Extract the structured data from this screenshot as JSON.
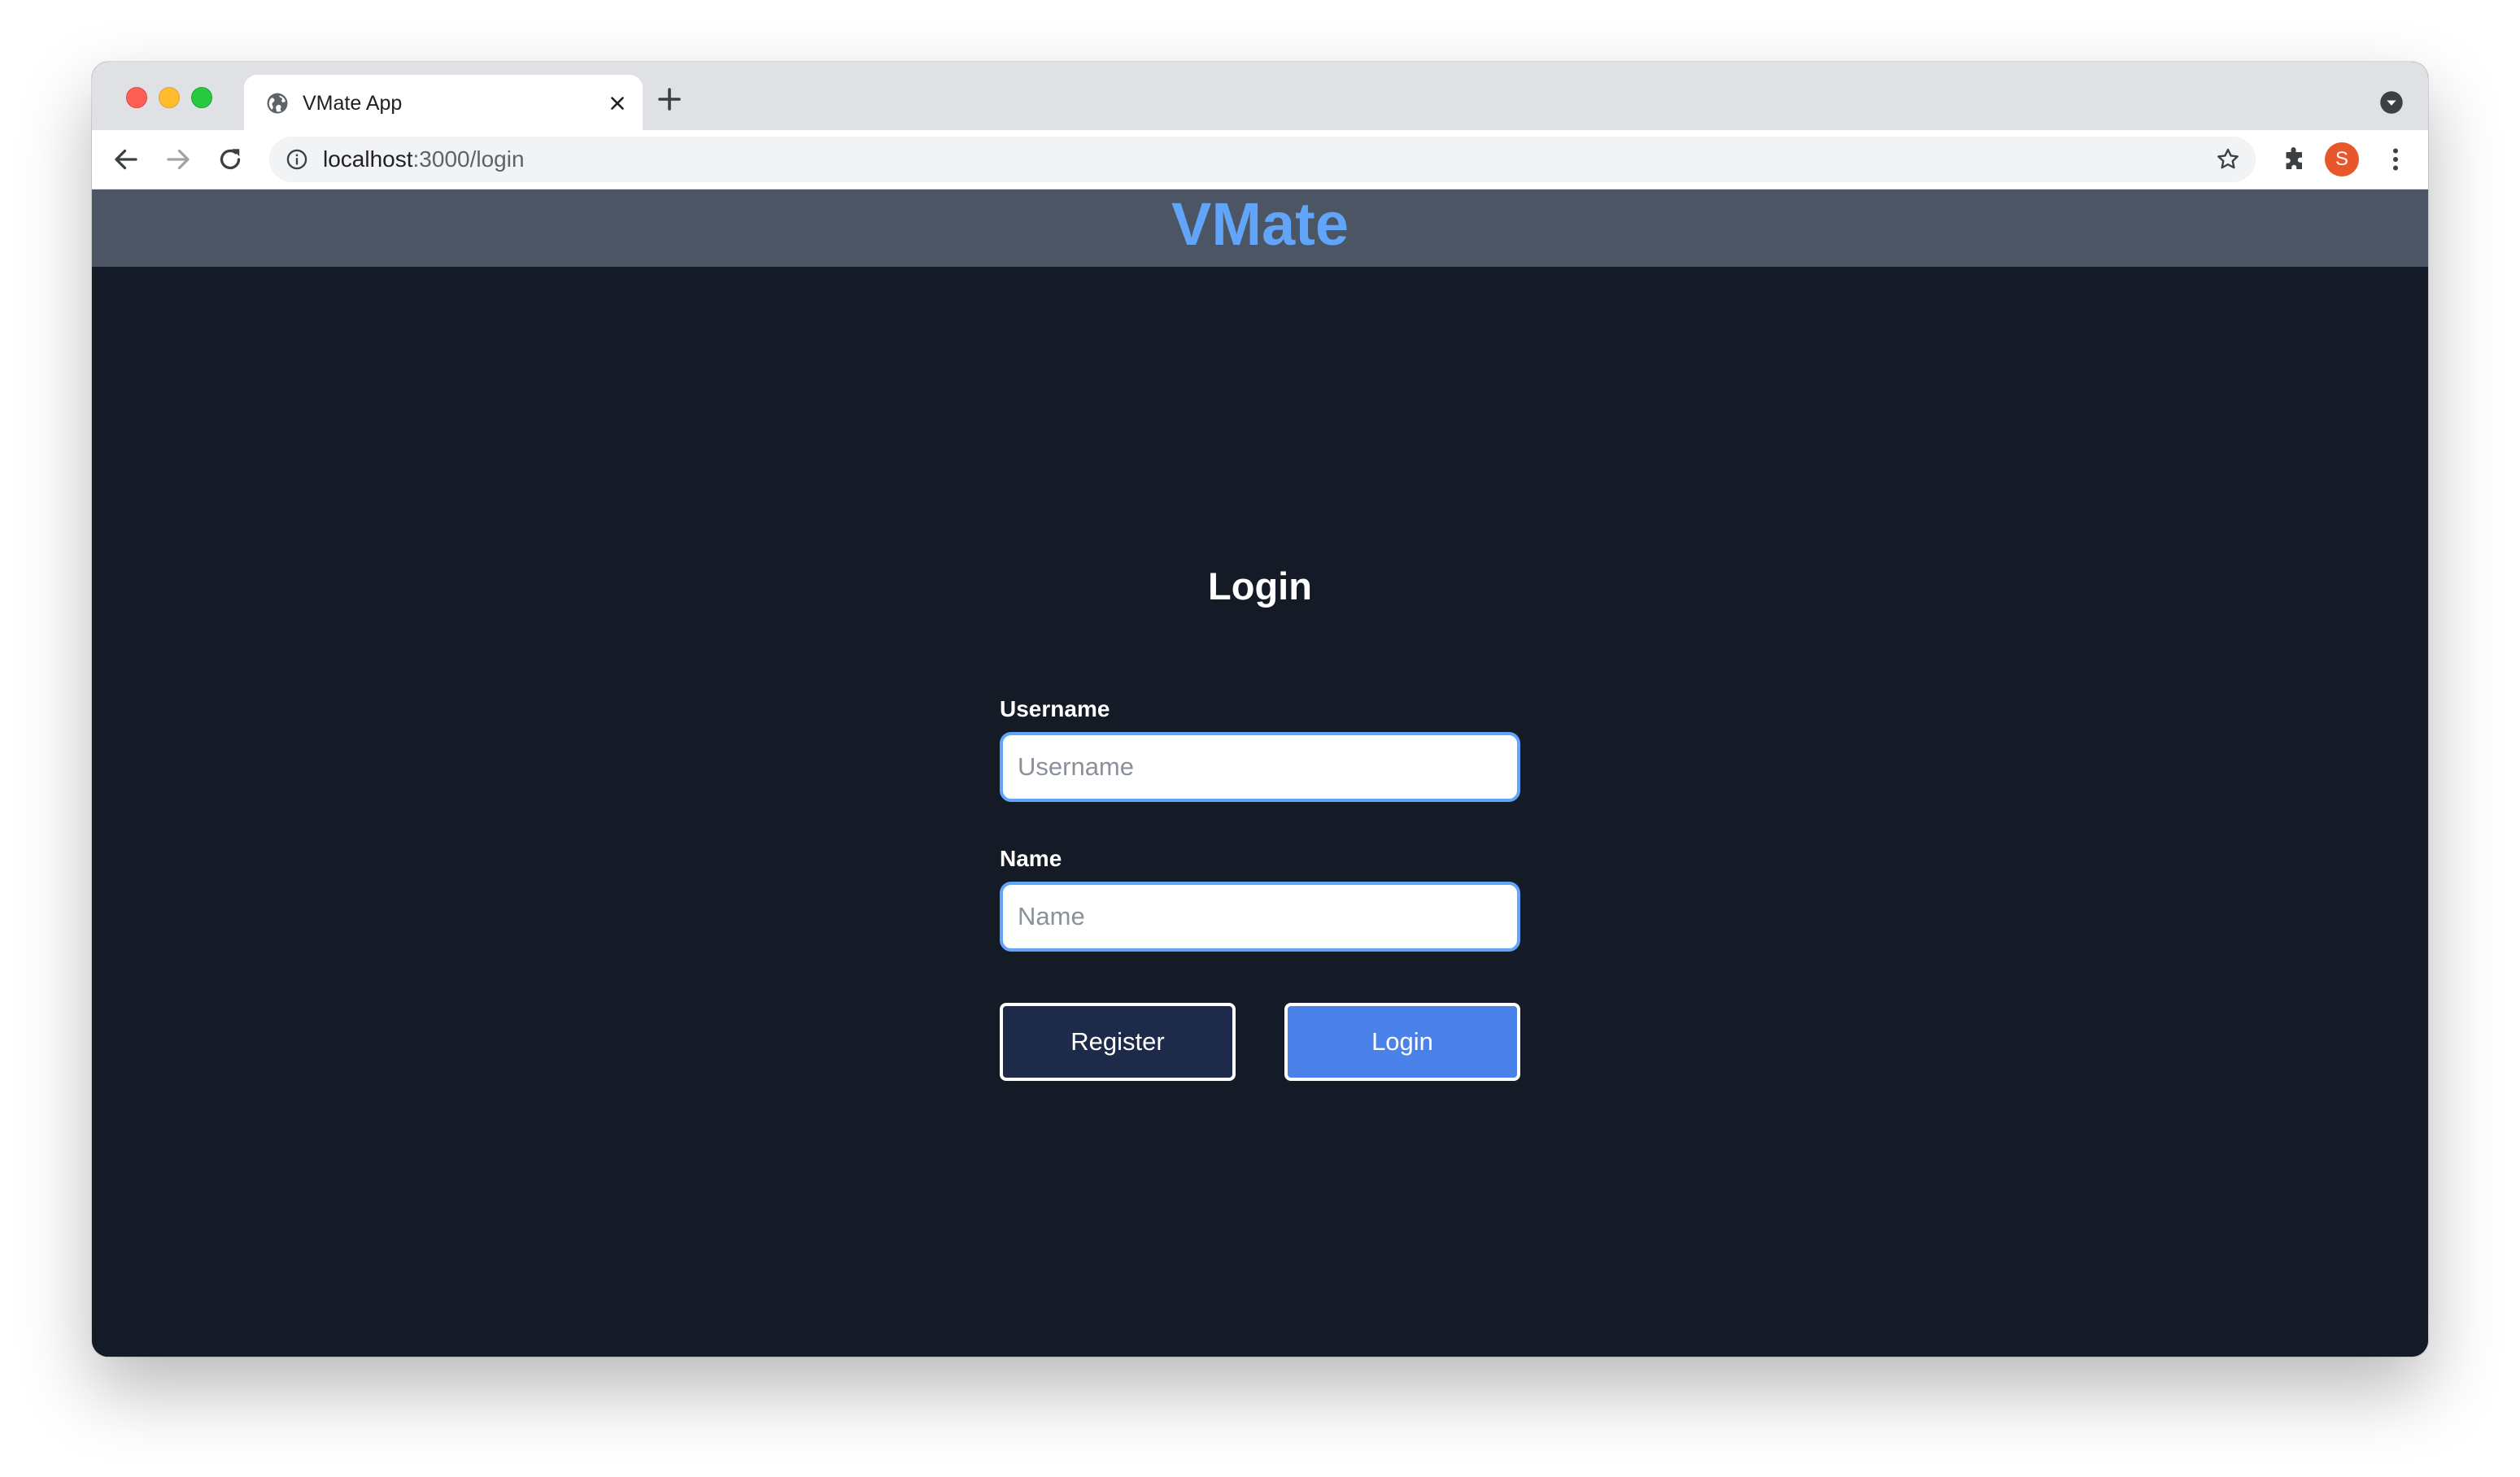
{
  "browser": {
    "tab": {
      "title": "VMate App",
      "favicon": "globe-icon"
    },
    "address_bar": {
      "host": "localhost",
      "path": ":3000/login"
    },
    "profile_initial": "S"
  },
  "header": {
    "brand": "VMate",
    "brand_color": "#60a5fa",
    "background": "#4b5563"
  },
  "login_form": {
    "title": "Login",
    "username": {
      "label": "Username",
      "placeholder": "Username",
      "value": ""
    },
    "name": {
      "label": "Name",
      "placeholder": "Name",
      "value": ""
    },
    "register_label": "Register",
    "login_label": "Login"
  },
  "colors": {
    "page_background": "#141a26",
    "login_button": "#4a82ea",
    "register_button": "#1e2a4a",
    "input_focus_border": "#60a5fa"
  }
}
